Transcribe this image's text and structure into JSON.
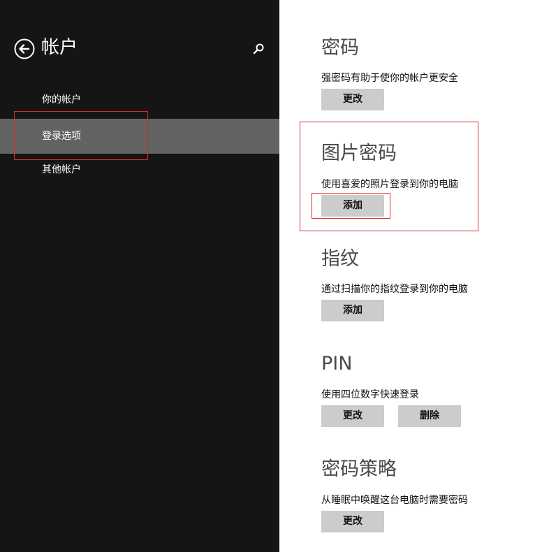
{
  "header": {
    "title": "帐户",
    "back_icon": "back-arrow-icon",
    "search_icon": "search-icon"
  },
  "sidebar": {
    "items": [
      {
        "label": "你的帐户",
        "selected": false
      },
      {
        "label": "登录选项",
        "selected": true
      },
      {
        "label": "其他帐户",
        "selected": false
      }
    ]
  },
  "sections": {
    "password": {
      "heading": "密码",
      "description": "强密码有助于使你的帐户更安全",
      "change_label": "更改"
    },
    "picture_password": {
      "heading": "图片密码",
      "description": "使用喜爱的照片登录到你的电脑",
      "add_label": "添加"
    },
    "fingerprint": {
      "heading": "指纹",
      "description": "通过扫描你的指纹登录到你的电脑",
      "add_label": "添加"
    },
    "pin": {
      "heading": "PIN",
      "description": "使用四位数字快速登录",
      "change_label": "更改",
      "remove_label": "删除"
    },
    "password_policy": {
      "heading": "密码策略",
      "description": "从睡眠中唤醒这台电脑时需要密码",
      "change_label": "更改"
    }
  },
  "colors": {
    "sidebar_bg": "#151515",
    "selected_item_bg": "#636363",
    "button_bg": "#cccccc",
    "annotation": "#d62b2b"
  }
}
